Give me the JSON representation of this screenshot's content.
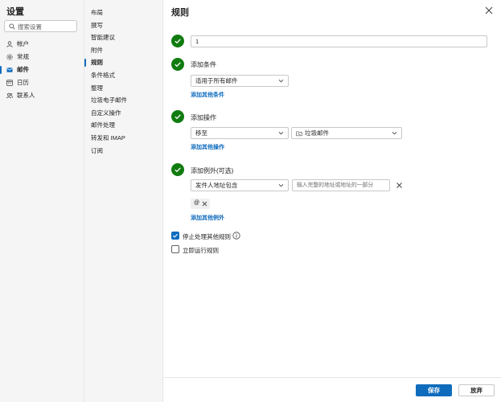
{
  "settings": {
    "title": "设置",
    "search_placeholder": "搜索设置",
    "nav": [
      {
        "label": "帐户",
        "icon": "person-icon"
      },
      {
        "label": "常规",
        "icon": "gear-icon"
      },
      {
        "label": "邮件",
        "icon": "mail-icon"
      },
      {
        "label": "日历",
        "icon": "calendar-icon"
      },
      {
        "label": "联系人",
        "icon": "contacts-icon"
      }
    ],
    "active_nav": "邮件"
  },
  "mail_nav": {
    "items": [
      "布局",
      "撰写",
      "智能建议",
      "附件",
      "规则",
      "条件格式",
      "整理",
      "垃圾电子邮件",
      "自定义操作",
      "邮件处理",
      "转发和 IMAP",
      "订阅"
    ],
    "active": "规则"
  },
  "rule": {
    "title": "规则",
    "name_value": "1",
    "condition": {
      "label": "添加条件",
      "selected": "适用于所有邮件",
      "add_link": "添加其他条件"
    },
    "action": {
      "label": "添加操作",
      "selected": "移至",
      "folder": "垃圾邮件",
      "add_link": "添加其他操作"
    },
    "exception": {
      "label": "添加例外(可选)",
      "selected": "发件人地址包含",
      "input_placeholder": "输入完整的地址或地址的一部分",
      "chip": "@",
      "add_link": "添加其他例外"
    },
    "stop_processing": {
      "label": "停止处理其他规则",
      "checked": true
    },
    "run_now": {
      "label": "立即运行规则",
      "checked": false
    }
  },
  "footer": {
    "save_label": "保存",
    "discard_label": "放弃"
  },
  "colors": {
    "accent": "#0f6cbd",
    "success": "#107c10"
  }
}
